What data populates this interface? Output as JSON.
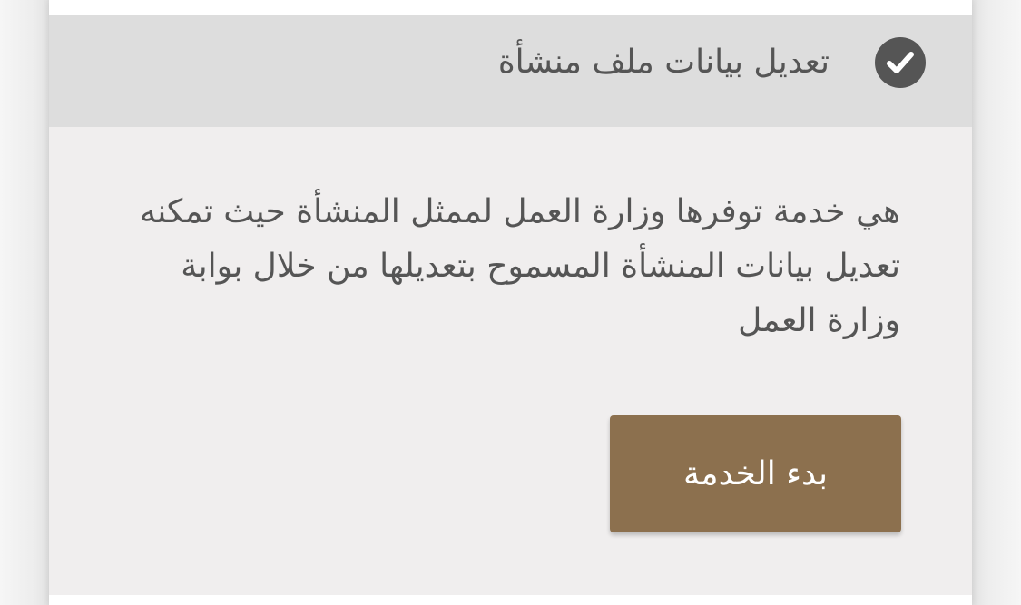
{
  "service": {
    "title": "تعديل بيانات ملف منشأة",
    "status_icon": "check-circle-icon",
    "description": "هي خدمة توفرها وزارة العمل لممثل المنشأة حيث تمكنه تعديل بيانات المنشأة المسموح بتعديلها من خلال بوابة وزارة العمل",
    "start_button_label": "بدء الخدمة"
  },
  "colors": {
    "header_bg": "#dddddd",
    "body_bg": "#f0eeee",
    "button_bg": "#8c704e",
    "text": "#555555",
    "icon_bg": "#555555"
  }
}
